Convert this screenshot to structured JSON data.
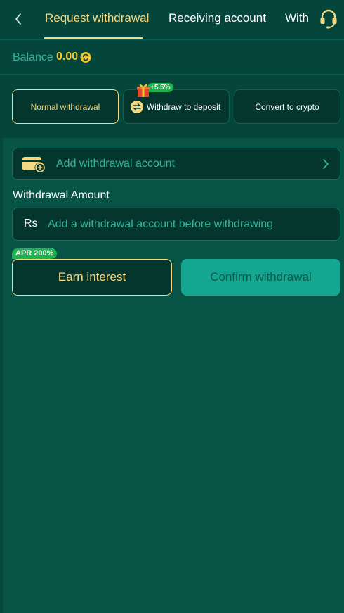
{
  "header": {
    "tabs": [
      {
        "label": "Request withdrawal",
        "active": true
      },
      {
        "label": "Receiving account",
        "active": false
      },
      {
        "label": "With",
        "active": false
      }
    ],
    "back_icon": "chevron-left-icon",
    "support_icon": "headset-icon"
  },
  "balance": {
    "label": "Balance",
    "value": "0.00",
    "refresh_icon": "refresh-icon"
  },
  "methods": [
    {
      "label": "Normal withdrawal",
      "selected": true
    },
    {
      "label": "Withdraw to deposit",
      "selected": false,
      "badge": "+5.5%",
      "icon": "swap-icon"
    },
    {
      "label": "Convert to crypto",
      "selected": false
    }
  ],
  "add_account": {
    "label": "Add withdrawal account",
    "icon": "card-add-icon"
  },
  "amount": {
    "label": "Withdrawal Amount",
    "currency": "Rs",
    "placeholder": "Add a withdrawal account before withdrawing",
    "value": ""
  },
  "actions": {
    "apr_badge": "APR 200%",
    "earn_label": "Earn interest",
    "confirm_label": "Confirm withdrawal"
  },
  "colors": {
    "background": "#075446",
    "header_bg": "#05463c",
    "accent_gold": "#f3d983",
    "balance_value": "#f4c531",
    "teal_text": "#34b39b",
    "confirm_bg": "#14a690",
    "badge_green": "#1bb34b"
  }
}
